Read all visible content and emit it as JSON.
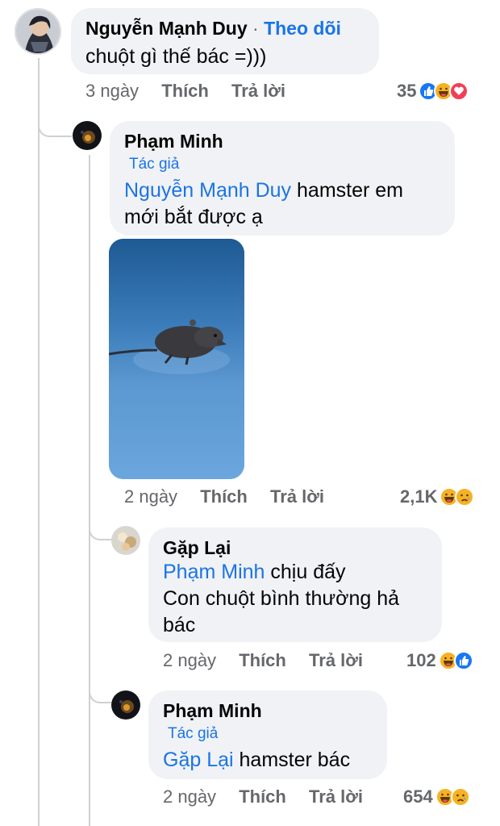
{
  "comments": [
    {
      "author": "Nguyễn Mạnh Duy",
      "follow": "Theo dõi",
      "text": "chuột gì thế bác =)))",
      "time": "3 ngày",
      "like": "Thích",
      "reply": "Trả lời",
      "reaction_count": "35",
      "reactions": [
        "like-icon",
        "haha-icon",
        "love-icon"
      ]
    },
    {
      "author": "Phạm Minh",
      "badge": "Tác giả",
      "mention": "Nguyễn Mạnh Duy",
      "text_line1": " hamster em",
      "text_line2": "mới bắt được ạ",
      "time": "2 ngày",
      "like": "Thích",
      "reply": "Trả lời",
      "reaction_count": "2,1K",
      "reactions": [
        "haha-icon",
        "sad-icon"
      ]
    },
    {
      "author": "Gặp Lại",
      "mention": "Phạm Minh",
      "text_line1": " chịu đấy",
      "text_line2": "Con chuột bình thường hả",
      "text_line3": "bác",
      "time": "2 ngày",
      "like": "Thích",
      "reply": "Trả lời",
      "reaction_count": "102",
      "reactions": [
        "haha-icon",
        "like-icon"
      ]
    },
    {
      "author": "Phạm Minh",
      "badge": "Tác giả",
      "mention": "Gặp Lại",
      "text_line1": " hamster bác",
      "time": "2 ngày",
      "like": "Thích",
      "reply": "Trả lời",
      "reaction_count": "654",
      "reactions": [
        "haha-icon",
        "sad-icon"
      ]
    }
  ],
  "colors": {
    "link": "#1b74e4",
    "bubble": "#f0f2f5",
    "meta": "#65676b",
    "like": "#1877f2",
    "haha": "#f7b125",
    "love": "#f33e58"
  }
}
